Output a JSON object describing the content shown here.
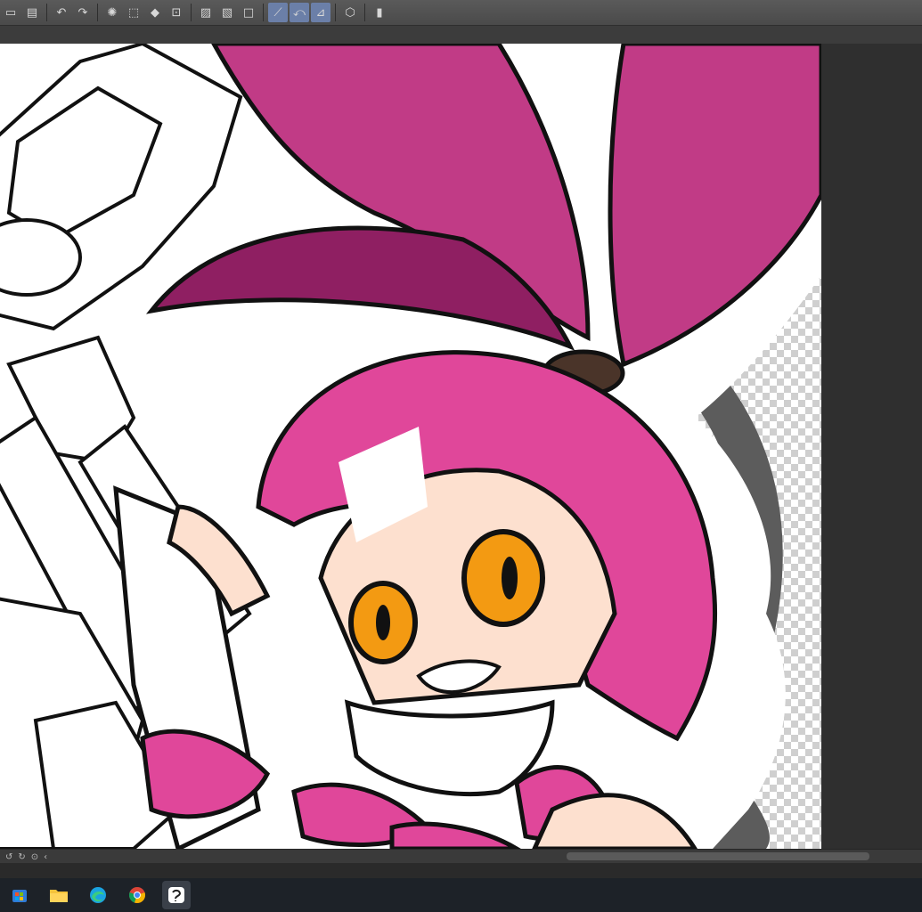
{
  "toolbar": {
    "icons": [
      "new-doc-icon",
      "save-icon",
      "export-icon",
      "undo-icon",
      "redo-icon",
      "loading-icon",
      "select-icon",
      "fill-icon",
      "transform-icon",
      "crop-icon",
      "lasso-icon",
      "rect-select-icon",
      "ruler-icon",
      "pen-ruler-icon",
      "curve-ruler-icon",
      "perspective-ruler-icon",
      "3d-icon",
      "device-icon"
    ]
  },
  "colors": {
    "hair": "#e0479a",
    "hair_dark": "#8f1f62",
    "eye": "#f39a12",
    "skin": "#fde0cf",
    "outline": "#111111",
    "ring": "#5c5c5c"
  },
  "taskbar": {
    "icons": [
      "store-icon",
      "file-explorer-icon",
      "edge-browser-icon",
      "chrome-icon",
      "clip-studio-icon"
    ]
  }
}
